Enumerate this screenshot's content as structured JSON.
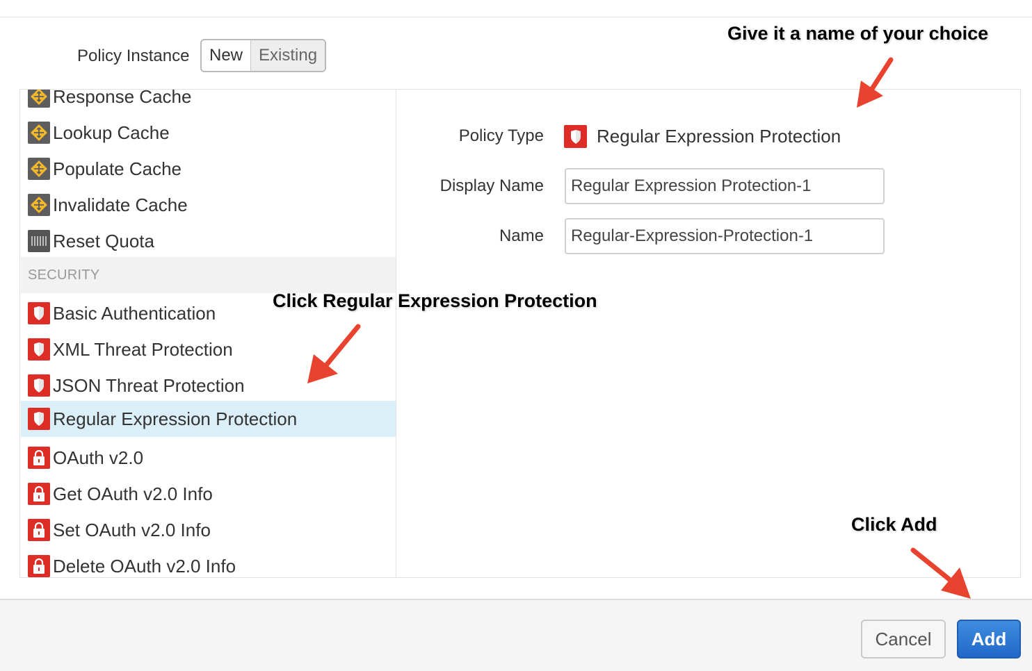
{
  "policy_instance": {
    "label": "Policy Instance",
    "options": [
      "New",
      "Existing"
    ],
    "selected": "New"
  },
  "policy_list": {
    "items_before": [
      {
        "label": "Response Cache",
        "icon": "cache-icon"
      },
      {
        "label": "Lookup Cache",
        "icon": "cache-icon"
      },
      {
        "label": "Populate Cache",
        "icon": "cache-icon"
      },
      {
        "label": "Invalidate Cache",
        "icon": "cache-icon"
      },
      {
        "label": "Reset Quota",
        "icon": "quota-icon"
      }
    ],
    "section": "SECURITY",
    "security_items": [
      {
        "label": "Basic Authentication",
        "icon": "shield-icon"
      },
      {
        "label": "XML Threat Protection",
        "icon": "shield-icon"
      },
      {
        "label": "JSON Threat Protection",
        "icon": "shield-icon"
      },
      {
        "label": "Regular Expression Protection",
        "icon": "shield-icon",
        "selected": true
      },
      {
        "label": "OAuth v2.0",
        "icon": "lock-icon"
      },
      {
        "label": "Get OAuth v2.0 Info",
        "icon": "lock-icon"
      },
      {
        "label": "Set OAuth v2.0 Info",
        "icon": "lock-icon"
      },
      {
        "label": "Delete OAuth v2.0 Info",
        "icon": "lock-icon"
      }
    ]
  },
  "form": {
    "policy_type_label": "Policy Type",
    "policy_type_value": "Regular Expression Protection",
    "display_name_label": "Display Name",
    "display_name_value": "Regular Expression Protection-1",
    "name_label": "Name",
    "name_value": "Regular-Expression-Protection-1"
  },
  "annotations": {
    "name_hint": "Give it a name of your choice",
    "select_hint": "Click Regular Expression Protection",
    "add_hint": "Click Add"
  },
  "buttons": {
    "cancel": "Cancel",
    "add": "Add"
  },
  "colors": {
    "security_icon": "#de2c26",
    "selected_row": "#dbeff9",
    "add_button": "#2f7bd6",
    "arrow": "#e8432e"
  }
}
